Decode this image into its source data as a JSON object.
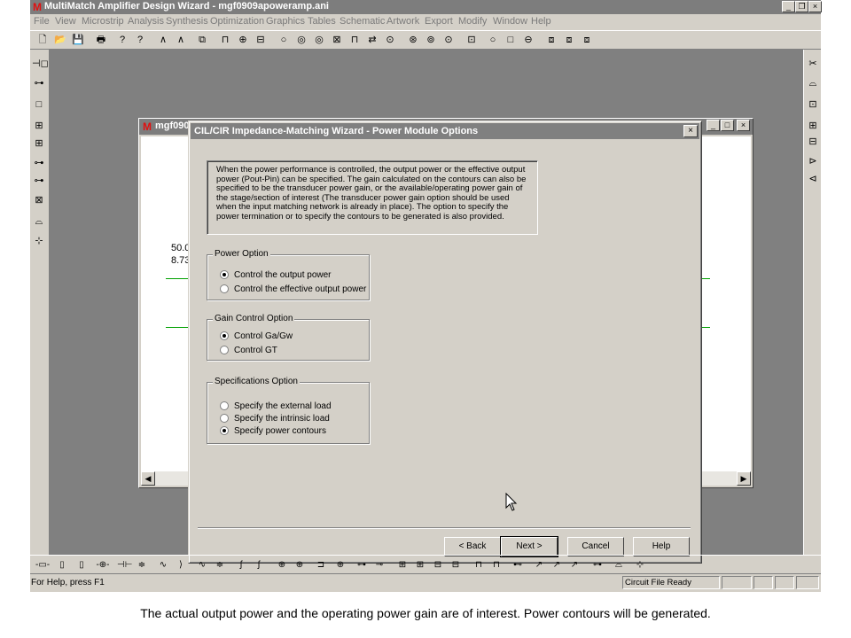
{
  "app": {
    "logo": "M",
    "title": "MultiMatch Amplifier Design Wizard - mgf0909apoweramp.ani",
    "win_controls": [
      "_",
      "❐",
      "×"
    ]
  },
  "menu": [
    "File",
    "View",
    "Microstrip",
    "Analysis",
    "Synthesis",
    "Optimization",
    "Graphics",
    "Tables",
    "Schematic",
    "Artwork",
    "Export",
    "Modify",
    "Window",
    "Help"
  ],
  "toolbar": [
    "🗋",
    "📂",
    "💾",
    "🖶",
    "?",
    "?",
    "∧",
    "∧",
    "⧉",
    "⊓",
    "⊕",
    "⊟",
    "○",
    "◎",
    "◎",
    "⊠",
    "⊓",
    "⇄",
    "⊙",
    "⊛",
    "⊚",
    "⊙",
    "⊡",
    "○",
    "□",
    "⊖",
    "⧈",
    "⧈",
    "⧈"
  ],
  "left_tools": [
    "⊣◻",
    "⊶",
    "□",
    "⊞",
    "⊞",
    "⊶",
    "⊶",
    "⊠",
    "⌓",
    "⊹"
  ],
  "right_tools": [
    "✂",
    "⌓",
    "⊡",
    "⊞",
    "⊟",
    "⊳",
    "⊲"
  ],
  "child_window": {
    "logo": "M",
    "title": "mgf090",
    "controls": [
      "_",
      "□",
      "×"
    ],
    "values": [
      "50.0",
      "8.73"
    ],
    "scroll": [
      "◀",
      "▶"
    ]
  },
  "dialog": {
    "title": "CIL/CIR Impedance-Matching Wizard - Power Module Options",
    "close": "×",
    "description": "When the power performance is controlled, the output power or the  effective output power (Pout-Pin) can be specified. The gain calculated on the contours can also be specified to be the transducer power  gain, or the available/operating power gain of the stage/section of interest (The transducer power gain option should be used when the input matching network is already in place). The option to specify the power termination or to specify the contours to be generated is also provided.",
    "power_option": {
      "legend": "Power Option",
      "options": [
        {
          "label": "Control the output power",
          "selected": true
        },
        {
          "label": "Control the effective output power",
          "selected": false
        }
      ]
    },
    "gain_option": {
      "legend": "Gain Control Option",
      "options": [
        {
          "label": "Control Ga/Gw",
          "selected": true
        },
        {
          "label": "Control GT",
          "selected": false
        }
      ]
    },
    "spec_option": {
      "legend": "Specifications Option",
      "options": [
        {
          "label": "Specify the external load",
          "selected": false
        },
        {
          "label": "Specify the intrinsic load",
          "selected": false
        },
        {
          "label": "Specify power contours",
          "selected": true
        }
      ]
    },
    "buttons": {
      "back": "< Back",
      "next": "Next >",
      "cancel": "Cancel",
      "help": "Help"
    }
  },
  "bottom_toolbar": [
    "-▭-",
    "▯",
    "▯",
    "-⊕-",
    "⊣⊢",
    "≑",
    "∿",
    "⟩",
    "∿",
    "≑",
    "ʃ",
    "ʃ",
    "⊕",
    "⊕",
    "⊐",
    "⊕",
    "⊶",
    "⊸",
    "⊞",
    "⊞",
    "⊟",
    "⊟",
    "⊓",
    "⊓",
    "⊷",
    "↗",
    "↗",
    "↗",
    "⊶",
    "⌓",
    "⊹"
  ],
  "status": {
    "help": "For Help, press F1",
    "file_state": "Circuit File Ready"
  },
  "caption": "The actual output power and the operating power gain are of interest. Power contours will be generated."
}
